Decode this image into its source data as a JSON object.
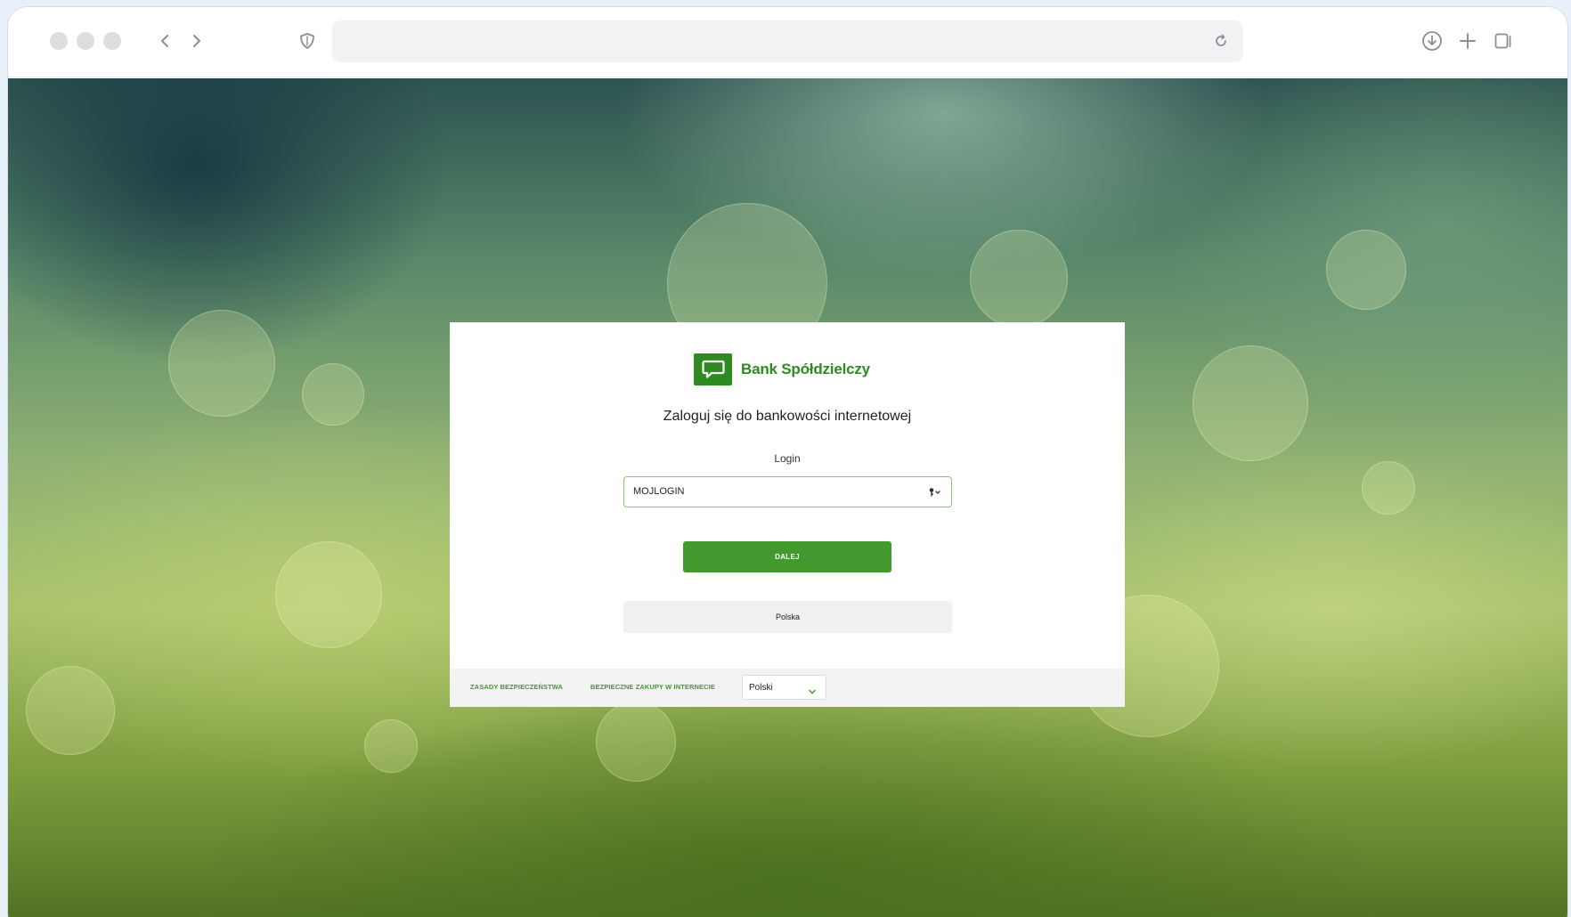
{
  "browser": {
    "address": "",
    "icons": [
      "back-chevron-icon",
      "forward-chevron-icon",
      "shield-icon",
      "reload-icon",
      "download-icon",
      "plus-icon",
      "tabs-icon"
    ]
  },
  "card": {
    "brand_name": "Bank Spółdzielczy",
    "heading": "Zaloguj się do bankowości internetowej",
    "login_label": "Login",
    "login_value": "MOJLOGIN",
    "next_button": "DALEJ",
    "language_button": "Polska",
    "footer": {
      "security_link": "ZASADY BEZPIECZEŃSTWA",
      "shopping_link": "BEZPIECZNE ZAKUPY W INTERNECIE",
      "language_select": "Polski"
    }
  },
  "colors": {
    "brand_green": "#2e8b21",
    "button_green": "#43992e",
    "input_border": "#8bc46f"
  }
}
